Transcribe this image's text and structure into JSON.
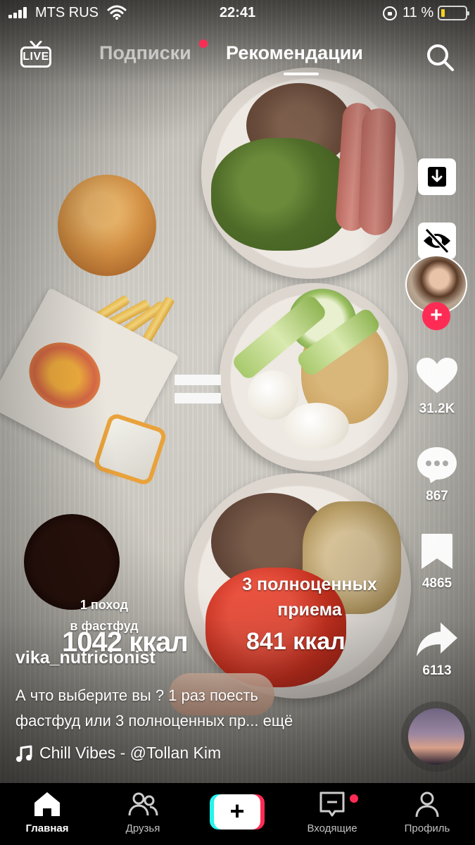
{
  "status_bar": {
    "carrier": "MTS RUS",
    "time": "22:41",
    "battery_percent": "11 %",
    "battery_level": 0.11
  },
  "top_nav": {
    "live_label": "LIVE",
    "tabs": [
      {
        "label": "Подписки",
        "active": false,
        "has_dot": true
      },
      {
        "label": "Рекомендации",
        "active": true
      }
    ],
    "search_icon": "search-icon"
  },
  "video": {
    "overlay_text": {
      "left_line1": "1 поход",
      "left_line2": "в фастфуд",
      "left_kcal": "1042 ккал",
      "right_line1": "3 полноценных",
      "right_line2": "приема",
      "right_kcal": "841 ккал"
    }
  },
  "right_rail": {
    "download_icon": "download-icon",
    "hide_icon": "eye-slash-icon",
    "like_count": "31.2K",
    "comment_count": "867",
    "bookmark_count": "4865",
    "share_count": "6113",
    "follow_label": "+"
  },
  "post": {
    "username": "vika_nutricionist",
    "caption_line1": "А что выберите вы ?  1 раз поесть",
    "caption_line2": "фастфуд или 3 полноценных пр... ещё",
    "sound": "Chill Vibes - @Tollan Kim"
  },
  "tab_bar": {
    "items": [
      {
        "label": "Главная",
        "icon": "home-icon",
        "active": true
      },
      {
        "label": "Друзья",
        "icon": "friends-icon"
      },
      {
        "label": "Входящие",
        "icon": "inbox-icon",
        "has_dot": true
      },
      {
        "label": "Профиль",
        "icon": "profile-icon"
      }
    ],
    "create_label": "+"
  },
  "colors": {
    "accent_red": "#fe2c55",
    "accent_cyan": "#25f4ee",
    "battery_yellow": "#f5d020"
  }
}
